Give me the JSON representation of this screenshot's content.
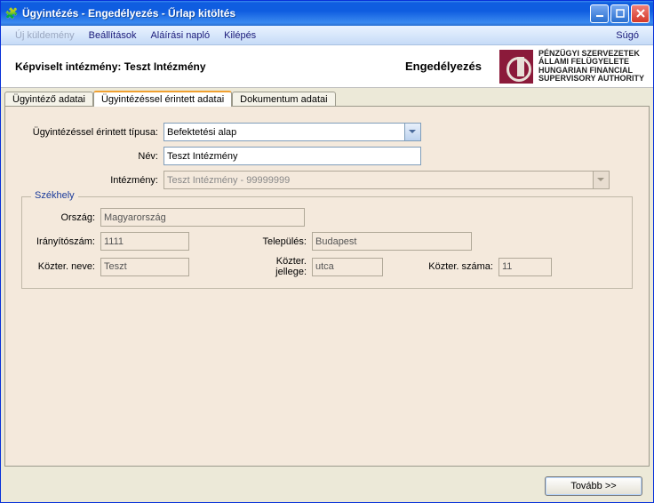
{
  "window": {
    "title": "Ügyintézés - Engedélyezés - Űrlap kitöltés"
  },
  "menu": {
    "new": "Új küldemény",
    "settings": "Beállítások",
    "sign_log": "Aláírási napló",
    "exit": "Kilépés",
    "help": "Súgó"
  },
  "header": {
    "rep_label": "Képviselt intézmény: Teszt Intézmény",
    "mid": "Engedélyezés",
    "org_l1": "PÉNZÜGYI SZERVEZETEK",
    "org_l2": "ÁLLAMI FELÜGYELETE",
    "org_l3": "HUNGARIAN FINANCIAL",
    "org_l4": "SUPERVISORY AUTHORITY"
  },
  "tabs": {
    "t1": "Ügyintéző adatai",
    "t2": "Ügyintézéssel érintett adatai",
    "t3": "Dokumentum adatai"
  },
  "form": {
    "type_label": "Ügyintézéssel érintett típusa:",
    "type_value": "Befektetési alap",
    "name_label": "Név:",
    "name_value": "Teszt Intézmény",
    "inst_label": "Intézmény:",
    "inst_value": "Teszt Intézmény - 99999999",
    "group_title": "Székhely",
    "country_label": "Ország:",
    "country_value": "Magyarország",
    "zip_label": "Irányítószám:",
    "zip_value": "1111",
    "city_label": "Település:",
    "city_value": "Budapest",
    "street_label": "Közter. neve:",
    "street_value": "Teszt",
    "stype_label": "Közter. jellege:",
    "stype_value": "utca",
    "snum_label": "Közter. száma:",
    "snum_value": "11"
  },
  "footer": {
    "next": "Tovább >>"
  }
}
